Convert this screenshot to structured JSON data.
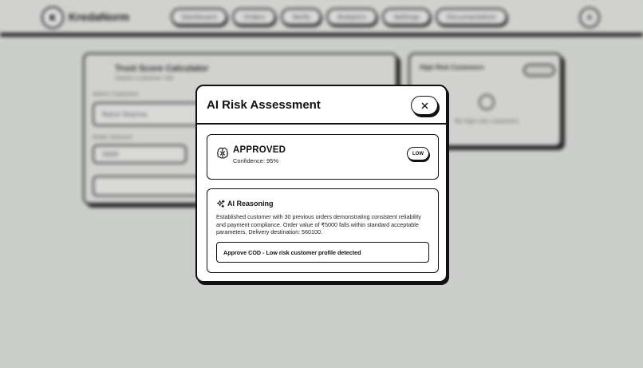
{
  "app": {
    "logo_initial": "K",
    "name": "KredaNorm",
    "nav": [
      "Dashboard",
      "Orders",
      "Verify",
      "Analytics",
      "Settings",
      "Documentation"
    ],
    "profile_initial": "A"
  },
  "background": {
    "left_card": {
      "title": "Trust Score Calculator",
      "subtitle": "Assess customer risk",
      "field1_label": "Select Customer",
      "field1_value": "Rahul Sharma",
      "field2_label": "Order Amount",
      "field2_value": "5000",
      "action_label": "Analyze Risk"
    },
    "right_card": {
      "title": "High Risk Customers",
      "empty_text": "No high risk customers"
    }
  },
  "modal": {
    "title": "AI Risk Assessment",
    "close_symbol": "×",
    "status": {
      "label": "APPROVED",
      "confidence": "Confidence: 95%",
      "risk_level": "LOW"
    },
    "reasoning": {
      "title": "AI Reasoning",
      "text": "Established customer with 30 previous orders demonstrating consistent reliability and payment compliance. Order value of ₹5000 falls within standard acceptable parameters. Delivery destination: 560100.",
      "recommendation": "Approve COD - Low risk customer profile detected"
    }
  },
  "colors": {
    "ink": "#111111",
    "background": "#e8ebe7",
    "card": "#ffffff"
  },
  "icons": [
    "brain-icon",
    "sparkles-icon",
    "close-icon"
  ]
}
